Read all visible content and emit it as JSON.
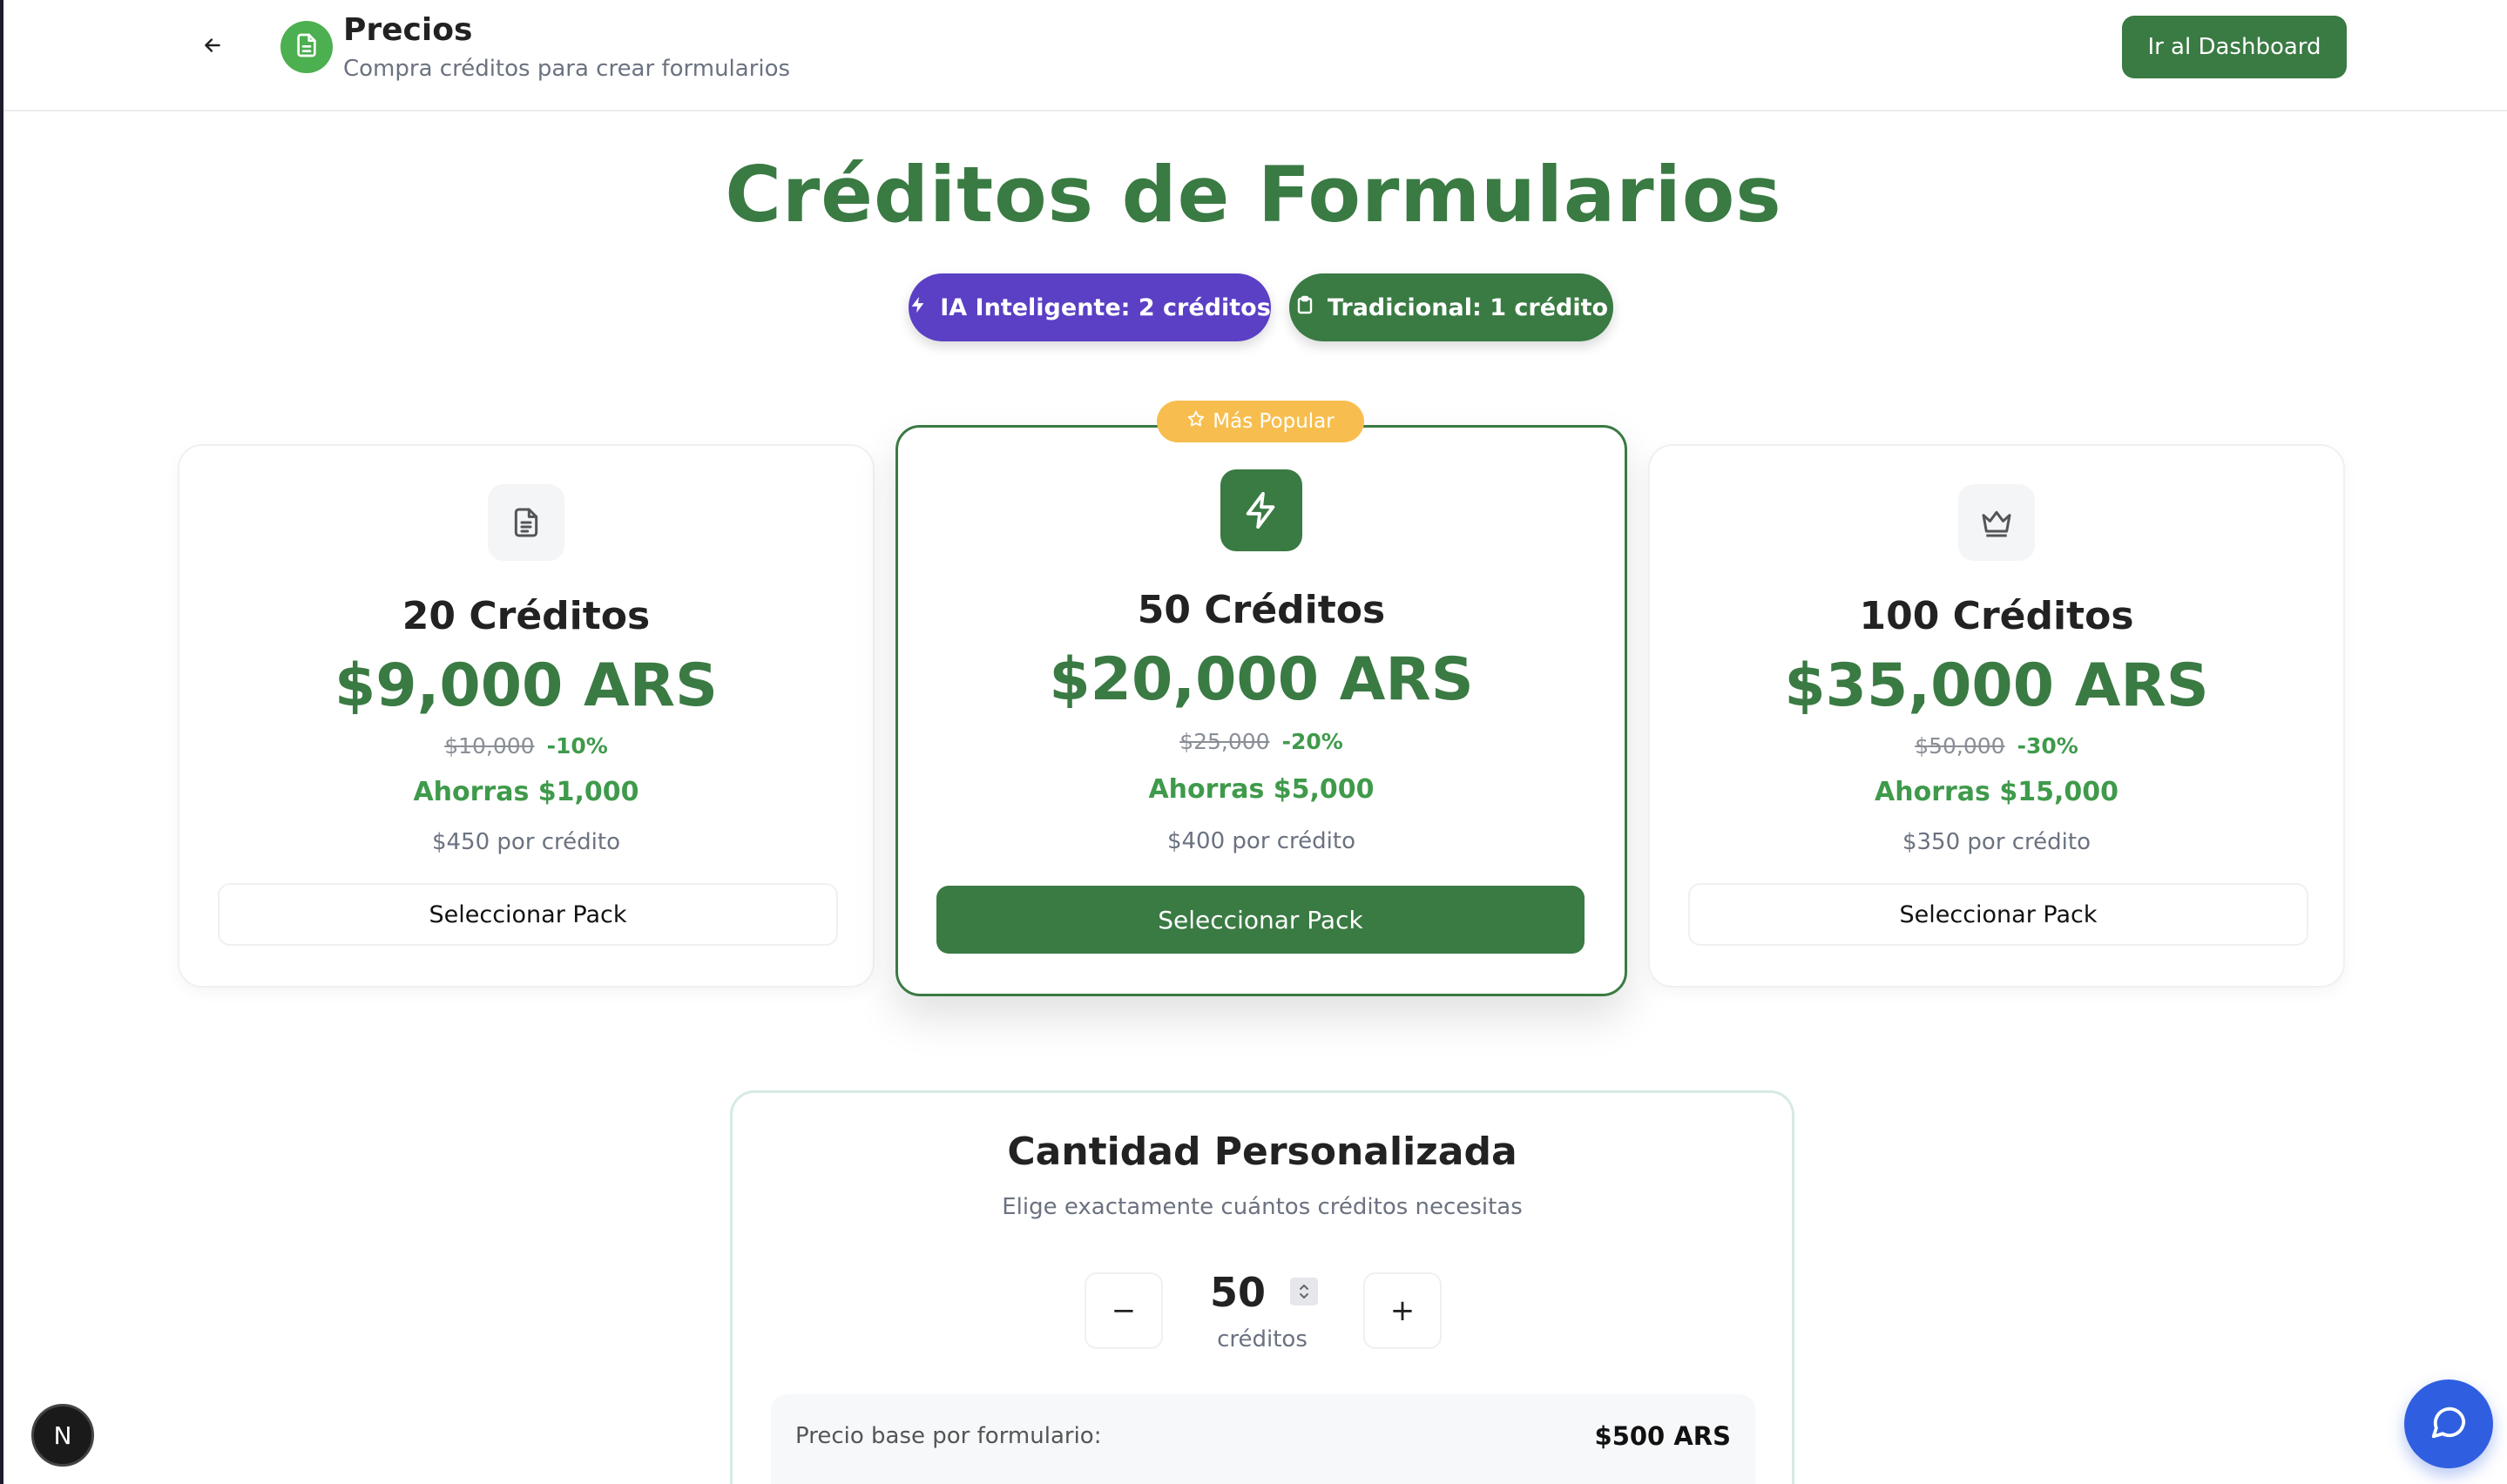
{
  "header": {
    "title": "Precios",
    "subtitle": "Compra créditos para crear formularios",
    "dashboard_label": "Ir al Dashboard"
  },
  "hero": {
    "title": "Créditos de Formularios",
    "pill_ai": "IA Inteligente: 2 créditos",
    "pill_traditional": "Tradicional: 1 crédito"
  },
  "popular_badge": "Más Popular",
  "packs": [
    {
      "credits": "20 Créditos",
      "price": "$9,000 ARS",
      "original": "$10,000",
      "discount": "-10%",
      "savings": "Ahorras $1,000",
      "per_credit": "$450 por crédito",
      "button": "Seleccionar Pack",
      "icon": "document-icon"
    },
    {
      "credits": "50 Créditos",
      "price": "$20,000 ARS",
      "original": "$25,000",
      "discount": "-20%",
      "savings": "Ahorras $5,000",
      "per_credit": "$400 por crédito",
      "button": "Seleccionar Pack",
      "icon": "lightning-icon"
    },
    {
      "credits": "100 Créditos",
      "price": "$35,000 ARS",
      "original": "$50,000",
      "discount": "-30%",
      "savings": "Ahorras $15,000",
      "per_credit": "$350 por crédito",
      "button": "Seleccionar Pack",
      "icon": "crown-icon"
    }
  ],
  "custom": {
    "title": "Cantidad Personalizada",
    "subtitle": "Elige exactamente cuántos créditos necesitas",
    "quantity": "50",
    "quantity_label": "créditos",
    "minus": "−",
    "plus": "+",
    "rows": [
      {
        "label": "Precio base por formulario:",
        "value": "$500 ARS"
      }
    ]
  },
  "floating": {
    "n_badge": "N"
  },
  "colors": {
    "primary_green": "#3a7a43",
    "accent_green": "#3f9a4b",
    "ai_purple": "#5b3fc4",
    "badge_yellow": "#f7be4f",
    "chat_blue": "#2f5fe0"
  }
}
